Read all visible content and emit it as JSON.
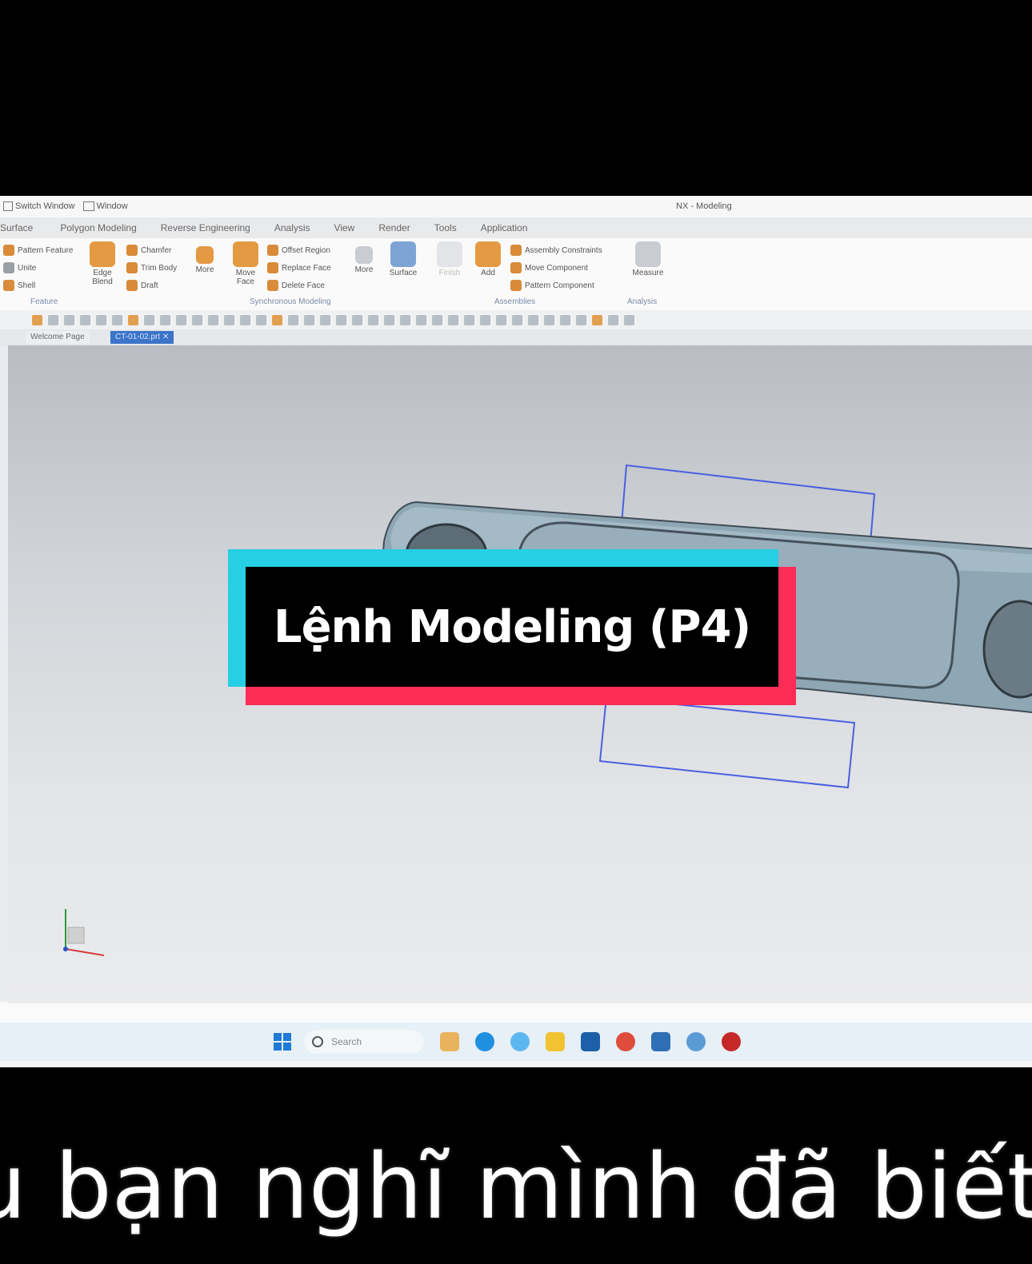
{
  "title_bar": {
    "switch_window": "Switch Window",
    "window": "Window",
    "app_title": "NX - Modeling"
  },
  "menu": [
    "Surface",
    "Polygon Modeling",
    "Reverse Engineering",
    "Analysis",
    "View",
    "Render",
    "Tools",
    "Application"
  ],
  "ribbon": {
    "feature": {
      "items": [
        "Pattern Feature",
        "Unite",
        "Shell"
      ],
      "edge_blend": "Edge Blend",
      "items2": [
        "Chamfer",
        "Trim Body",
        "Draft"
      ],
      "more": "More",
      "label": "Feature"
    },
    "sync": {
      "move_face": "Move Face",
      "items": [
        "Offset Region",
        "Replace Face",
        "Delete Face"
      ],
      "more": "More",
      "label": "Synchronous Modeling"
    },
    "surface": {
      "label": "Surface"
    },
    "assemblies": {
      "finish": "Finish",
      "add": "Add",
      "items": [
        "Assembly Constraints",
        "Move Component",
        "Pattern Component"
      ],
      "label": "Assemblies"
    },
    "analysis": {
      "measure": "Measure",
      "label": "Analysis"
    }
  },
  "tabs": {
    "welcome": "Welcome Page",
    "active": "CT-01-02.prt"
  },
  "taskbar": {
    "search_placeholder": "Search"
  },
  "overlay": {
    "title": "Lệnh Modeling (P4)",
    "subtitle": "u bạn nghĩ mình đã biết h"
  },
  "colors": {
    "banner_cyan": "#26cfe4",
    "banner_red": "#fb2c56",
    "part_color": "#8fa7b4",
    "datum_plane": "#4a5fe0"
  }
}
